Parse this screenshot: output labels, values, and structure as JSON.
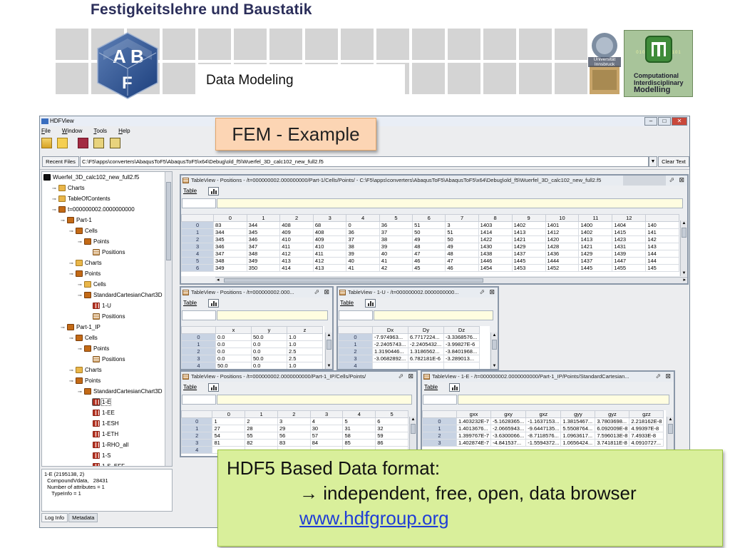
{
  "header": {
    "title": "Festigkeitslehre und Baustatik",
    "section": "Data Modeling"
  },
  "logos": {
    "uni": "Universität Innsbruck",
    "cim": [
      "Computational",
      "Interdisciplinary",
      "Modelling"
    ],
    "cim_bits": "0101 0101010101"
  },
  "app": {
    "title": "HDFView",
    "menu": [
      {
        "label": "File",
        "key": "F"
      },
      {
        "label": "Window",
        "key": "W"
      },
      {
        "label": "Tools",
        "key": "T"
      },
      {
        "label": "Help",
        "key": "H"
      }
    ],
    "recent_label": "Recent Files",
    "recent_path": "C:\\F5\\apps\\converters\\AbaqusToF5\\AbaqusToF5\\x64\\Debug\\old_f5\\Wuerfel_3D_calc102_new_full2.f5",
    "clear_label": "Clear Text",
    "tree": [
      {
        "d": 0,
        "icon": "h5",
        "label": "Wuerfel_3D_calc102_new_full2.f5"
      },
      {
        "d": 1,
        "icon": "fold",
        "label": "Charts"
      },
      {
        "d": 1,
        "icon": "fold",
        "label": "TableOfContents"
      },
      {
        "d": 1,
        "icon": "grp",
        "label": "t=000000002.0000000000"
      },
      {
        "d": 2,
        "icon": "grp",
        "label": "Part-1"
      },
      {
        "d": 3,
        "icon": "grp",
        "label": "Cells"
      },
      {
        "d": 4,
        "icon": "grp",
        "label": "Points"
      },
      {
        "d": 5,
        "icon": "tbl",
        "label": "Positions"
      },
      {
        "d": 3,
        "icon": "fold",
        "label": "Charts"
      },
      {
        "d": 3,
        "icon": "grp",
        "label": "Points"
      },
      {
        "d": 4,
        "icon": "fold",
        "label": "Cells"
      },
      {
        "d": 4,
        "icon": "grp",
        "label": "StandardCartesianChart3D"
      },
      {
        "d": 5,
        "icon": "dat",
        "label": "1-U"
      },
      {
        "d": 5,
        "icon": "tbl",
        "label": "Positions"
      },
      {
        "d": 2,
        "icon": "grp",
        "label": "Part-1_IP"
      },
      {
        "d": 3,
        "icon": "grp",
        "label": "Cells"
      },
      {
        "d": 4,
        "icon": "grp",
        "label": "Points"
      },
      {
        "d": 5,
        "icon": "tbl",
        "label": "Positions"
      },
      {
        "d": 3,
        "icon": "fold",
        "label": "Charts"
      },
      {
        "d": 3,
        "icon": "grp",
        "label": "Points"
      },
      {
        "d": 4,
        "icon": "grp",
        "label": "StandardCartesianChart3D"
      },
      {
        "d": 5,
        "icon": "dat",
        "label": "1-E",
        "sel": true
      },
      {
        "d": 5,
        "icon": "dat",
        "label": "1-EE"
      },
      {
        "d": 5,
        "icon": "dat",
        "label": "1-ESH"
      },
      {
        "d": 5,
        "icon": "dat",
        "label": "1-ETH"
      },
      {
        "d": 5,
        "icon": "dat",
        "label": "1-RHO_all"
      },
      {
        "d": 5,
        "icon": "dat",
        "label": "1-S"
      },
      {
        "d": 5,
        "icon": "dat",
        "label": "1-S_EFF"
      }
    ],
    "info": [
      "1-E (2195138, 2)",
      "  CompoundVdata,   28431",
      "  Number of attributes = 1",
      "     TypeInfo = 1"
    ],
    "tabs": [
      "Log Info",
      "Metadata"
    ]
  },
  "table_menu": "Table",
  "panels": {
    "p1": {
      "title": "TableView - Positions - /t=000000002.000000000/Part-1/Cells/Points/ - C:\\F5\\apps\\converters\\AbaqusToF5\\AbaqusToF5\\x64\\Debug\\old_f5\\Wuerfel_3D_calc102_new_full2.f5",
      "cols": [
        "0",
        "1",
        "2",
        "3",
        "4",
        "5",
        "6",
        "7",
        "8",
        "9",
        "10",
        "11",
        "12"
      ],
      "rows": [
        [
          "0",
          "83",
          "344",
          "408",
          "68",
          "0",
          "36",
          "51",
          "3",
          "1403",
          "1402",
          "1401",
          "1400",
          "1404",
          "140"
        ],
        [
          "1",
          "344",
          "345",
          "409",
          "408",
          "36",
          "37",
          "50",
          "51",
          "1414",
          "1413",
          "1412",
          "1402",
          "1415",
          "141"
        ],
        [
          "2",
          "345",
          "346",
          "410",
          "409",
          "37",
          "38",
          "49",
          "50",
          "1422",
          "1421",
          "1420",
          "1413",
          "1423",
          "142"
        ],
        [
          "3",
          "346",
          "347",
          "411",
          "410",
          "38",
          "39",
          "48",
          "49",
          "1430",
          "1429",
          "1428",
          "1421",
          "1431",
          "143"
        ],
        [
          "4",
          "347",
          "348",
          "412",
          "411",
          "39",
          "40",
          "47",
          "48",
          "1438",
          "1437",
          "1436",
          "1429",
          "1439",
          "144"
        ],
        [
          "5",
          "348",
          "349",
          "413",
          "412",
          "40",
          "41",
          "46",
          "47",
          "1446",
          "1445",
          "1444",
          "1437",
          "1447",
          "144"
        ],
        [
          "6",
          "349",
          "350",
          "414",
          "413",
          "41",
          "42",
          "45",
          "46",
          "1454",
          "1453",
          "1452",
          "1445",
          "1455",
          "145"
        ]
      ]
    },
    "p2": {
      "title": "TableView - Positions - /t=000000002.000...",
      "cols": [
        "x",
        "y",
        "z"
      ],
      "rows": [
        [
          "0",
          "0.0",
          "50.0",
          "1.0"
        ],
        [
          "1",
          "0.0",
          "0.0",
          "1.0"
        ],
        [
          "2",
          "0.0",
          "0.0",
          "2.5"
        ],
        [
          "3",
          "0.0",
          "50.0",
          "2.5"
        ],
        [
          "4",
          "50.0",
          "0.0",
          "1.0"
        ]
      ]
    },
    "p3": {
      "title": "TableView - 1-U - /t=000000002.0000000000...",
      "cols": [
        "Dx",
        "Dy",
        "Dz"
      ],
      "rows": [
        [
          "0",
          "-7.974963...",
          "6.7717224...",
          "-3.3368576..."
        ],
        [
          "1",
          "-2.2405743...",
          "-2.2405432...",
          "-3.99827E-6"
        ],
        [
          "2",
          "1.3190446...",
          "1.3186562...",
          "-3.8401968..."
        ],
        [
          "3",
          "-3.0682892...",
          "6.782181E-6",
          "-3.289013..."
        ],
        [
          "4",
          "",
          "",
          ""
        ]
      ]
    },
    "p4": {
      "title": "TableView - Positions - /t=000000002.0000000000/Part-1_IP/Cells/Points/",
      "cols": [
        "0",
        "1",
        "2",
        "3",
        "4",
        "5"
      ],
      "rows": [
        [
          "0",
          "1",
          "2",
          "3",
          "4",
          "5",
          "6"
        ],
        [
          "1",
          "27",
          "28",
          "29",
          "30",
          "31",
          "32"
        ],
        [
          "2",
          "54",
          "55",
          "56",
          "57",
          "58",
          "59"
        ],
        [
          "3",
          "81",
          "82",
          "83",
          "84",
          "85",
          "86"
        ],
        [
          "4",
          "",
          "",
          "",
          "",
          "",
          ""
        ]
      ]
    },
    "p5": {
      "title": "TableView - 1-E - /t=000000002.0000000000/Part-1_IP/Points/StandardCartesian...",
      "cols": [
        "gxx",
        "gxy",
        "gxz",
        "gyy",
        "gyz",
        "gzz"
      ],
      "rows": [
        [
          "0",
          "1.403232E-7",
          "-5.1628365...",
          "-1.1637153...",
          "1.3815467...",
          "3.7803698...",
          "2.218162E-8"
        ],
        [
          "1",
          "1.4013676...",
          "-2.0665943...",
          "-9.6447135...",
          "5.5508764...",
          "6.092009E-8",
          "4.99397E-8"
        ],
        [
          "2",
          "1.399767E-7",
          "-3.6300066...",
          "-8.7118576...",
          "1.0963617...",
          "7.596013E-8",
          "7.4933E-8"
        ],
        [
          "3",
          "1.402874E-7",
          "-4.841537...",
          "-1.5594372...",
          "1.0656424...",
          "3.741811E-8",
          "4.0910727..."
        ]
      ]
    }
  },
  "callouts": {
    "fem": "FEM - Example",
    "hdf_line1": "HDF5 Based Data format:",
    "hdf_arrow": "→",
    "hdf_line2": "independent, free, open, data browser",
    "hdf_link": "www.hdfgroup.org"
  }
}
